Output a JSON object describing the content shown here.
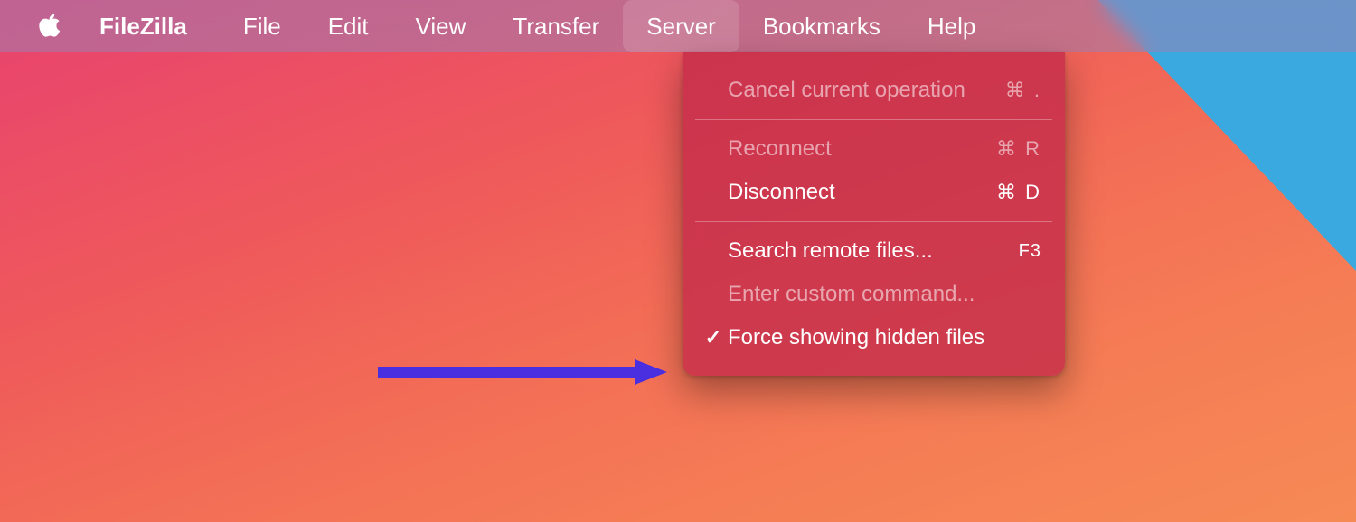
{
  "menubar": {
    "app": "FileZilla",
    "items": [
      "File",
      "Edit",
      "View",
      "Transfer",
      "Server",
      "Bookmarks",
      "Help"
    ],
    "active_index": 4
  },
  "dropdown": {
    "items": [
      {
        "label": "Cancel current operation",
        "shortcut": "⌘ .",
        "enabled": false,
        "checked": false
      },
      {
        "separator": true
      },
      {
        "label": "Reconnect",
        "shortcut": "⌘ R",
        "enabled": false,
        "checked": false
      },
      {
        "label": "Disconnect",
        "shortcut": "⌘ D",
        "enabled": true,
        "checked": false
      },
      {
        "separator": true
      },
      {
        "label": "Search remote files...",
        "shortcut": "F3",
        "enabled": true,
        "checked": false
      },
      {
        "label": "Enter custom command...",
        "shortcut": "",
        "enabled": false,
        "checked": false
      },
      {
        "label": "Force showing hidden files",
        "shortcut": "",
        "enabled": true,
        "checked": true
      }
    ]
  },
  "annotation": {
    "arrow_color": "#4a2fe0"
  }
}
